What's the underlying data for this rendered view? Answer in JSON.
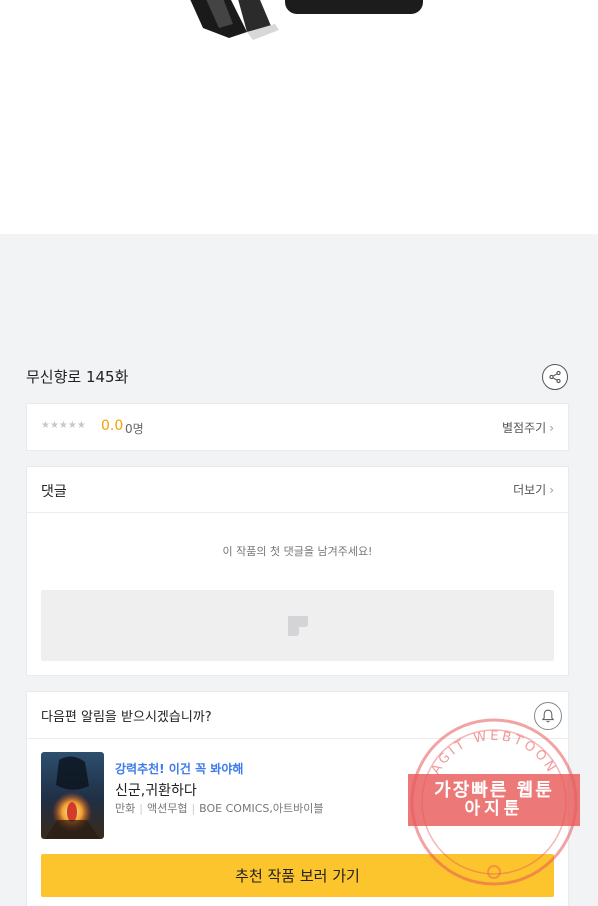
{
  "episode": {
    "title": "무신향로 145화"
  },
  "rating": {
    "stars": "★★★★★",
    "score": "0.0",
    "count": "0명",
    "rate_label": "별점주기"
  },
  "comments": {
    "title": "댓글",
    "more_label": "더보기",
    "empty_message": "이 작품의 첫 댓글을 남겨주세요!"
  },
  "notification": {
    "question": "다음편 알림을 받으시겠습니까?"
  },
  "recommendation": {
    "promo": "강력추천! 이건 꼭 봐야해",
    "title": "신군,귀환하다",
    "meta": [
      "만화",
      "액션무협",
      "BOE COMICS,아트바이블"
    ],
    "button_label": "추천 작품 보러 가기"
  },
  "watermark": {
    "line1": "가장빠른 웹툰",
    "line2": "아지툰",
    "ring_text": "AGIT WEBTOON",
    "color": "#e85a5a"
  },
  "colors": {
    "accent_yellow": "#fcc42d",
    "score_orange": "#f5a000",
    "promo_blue": "#3c7be8"
  },
  "icons": {
    "share": "share-icon",
    "chevron": "chevron-right-icon",
    "write": "pencil-icon",
    "bell": "bell-icon"
  }
}
